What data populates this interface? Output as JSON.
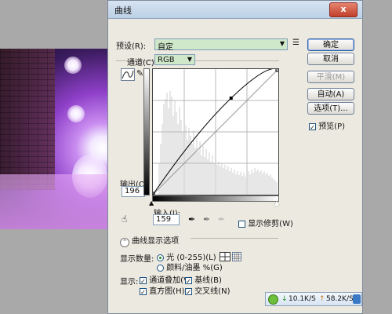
{
  "dialog": {
    "title": "曲线",
    "close_glyph": "x"
  },
  "preset": {
    "label": "预设(R):",
    "value": "自定"
  },
  "channel": {
    "label": "通道(C):",
    "value": "RGB"
  },
  "buttons": {
    "ok": "确定",
    "cancel": "取消",
    "smooth": "平滑(M)",
    "auto": "自动(A)",
    "options": "选项(T)..."
  },
  "preview": {
    "label": "预览(P)",
    "checked": true
  },
  "output": {
    "label": "输出(O):",
    "value": "196"
  },
  "input": {
    "label": "输入(I):",
    "value": "159"
  },
  "show_clipping": {
    "label": "显示修剪(W)",
    "checked": false
  },
  "curve_display_options": {
    "label": "曲线显示选项"
  },
  "show_amount": {
    "label": "显示数量:",
    "light": "光 (0-255)(L)",
    "pigment": "颜料/油墨 %(G)",
    "selected": "light"
  },
  "show": {
    "label": "显示:",
    "channel_overlays": "通道叠加(V)",
    "baseline": "基线(B)",
    "histogram": "直方图(H)",
    "intersection": "交叉线(N)"
  },
  "statusbar": {
    "down": "10.1K/S",
    "up": "58.2K/S"
  },
  "curve": {
    "control_point": {
      "input": 159,
      "output": 196
    }
  },
  "colors": {
    "preset_bg": "#cfe8c9",
    "close": "#c0402b",
    "accent": "#2f5fa8"
  }
}
